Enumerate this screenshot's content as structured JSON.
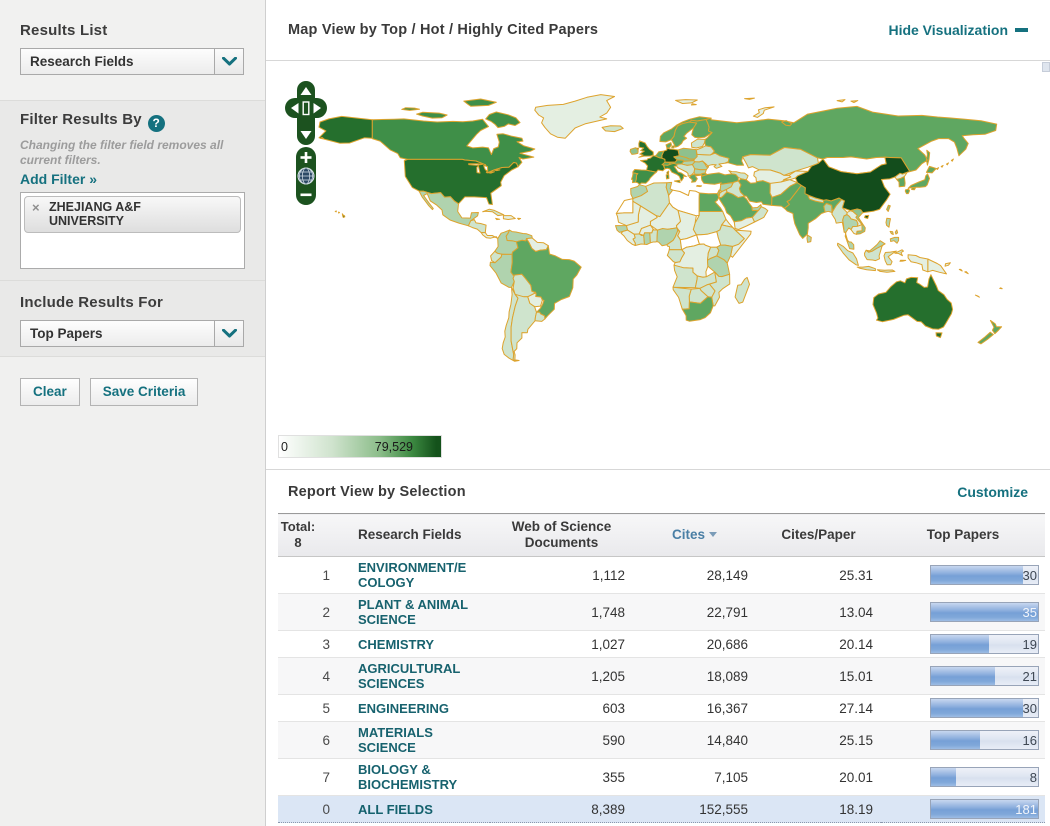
{
  "sidebar": {
    "results_list_label": "Results List",
    "results_list_value": "Research Fields",
    "filter_title": "Filter Results By",
    "filter_help": "?",
    "filter_note": "Changing the filter field removes all current filters.",
    "add_filter_label": "Add Filter »",
    "filter_tag": {
      "remove_icon": "×",
      "text": "ZHEJIANG A&F UNIVERSITY"
    },
    "include_results_label": "Include Results For",
    "include_results_value": "Top Papers",
    "clear_button": "Clear",
    "save_button": "Save Criteria"
  },
  "map": {
    "title": "Map View by Top / Hot / Highly Cited Papers",
    "hide_link": "Hide Visualization",
    "zoom_in": "+",
    "zoom_out": "−",
    "legend_min": "0",
    "legend_max": "79,529",
    "palette": [
      "#ffffff",
      "#e4efe2",
      "#cfe4cd",
      "#b0d3ae",
      "#8fc18d",
      "#5fa761",
      "#3f8f48",
      "#256f2d",
      "#134d1c"
    ],
    "border_color": "#dda32d"
  },
  "report": {
    "title": "Report View by Selection",
    "customize_link": "Customize",
    "total_label": "Total:",
    "total_value": "8",
    "columns": {
      "field": "Research Fields",
      "docs": "Web of Science Documents",
      "cites": "Cites",
      "cites_per_paper": "Cites/Paper",
      "top_papers": "Top Papers"
    },
    "sorted_by": "Cites",
    "rows": [
      {
        "rank": "1",
        "field": "ENVIRONMENT/ECOLOGY",
        "docs": "1,112",
        "cites": "28,149",
        "cites_per_paper": "25.31",
        "top_papers": "30",
        "bar_pct": 86,
        "total": false
      },
      {
        "rank": "2",
        "field": "PLANT & ANIMAL SCIENCE",
        "docs": "1,748",
        "cites": "22,791",
        "cites_per_paper": "13.04",
        "top_papers": "35",
        "bar_pct": 100,
        "total": false
      },
      {
        "rank": "3",
        "field": "CHEMISTRY",
        "docs": "1,027",
        "cites": "20,686",
        "cites_per_paper": "20.14",
        "top_papers": "19",
        "bar_pct": 54,
        "total": false
      },
      {
        "rank": "4",
        "field": "AGRICULTURAL SCIENCES",
        "docs": "1,205",
        "cites": "18,089",
        "cites_per_paper": "15.01",
        "top_papers": "21",
        "bar_pct": 60,
        "total": false
      },
      {
        "rank": "5",
        "field": "ENGINEERING",
        "docs": "603",
        "cites": "16,367",
        "cites_per_paper": "27.14",
        "top_papers": "30",
        "bar_pct": 86,
        "total": false
      },
      {
        "rank": "6",
        "field": "MATERIALS SCIENCE",
        "docs": "590",
        "cites": "14,840",
        "cites_per_paper": "25.15",
        "top_papers": "16",
        "bar_pct": 46,
        "total": false
      },
      {
        "rank": "7",
        "field": "BIOLOGY & BIOCHEMISTRY",
        "docs": "355",
        "cites": "7,105",
        "cites_per_paper": "20.01",
        "top_papers": "8",
        "bar_pct": 23,
        "total": false
      },
      {
        "rank": "0",
        "field": "ALL FIELDS",
        "docs": "8,389",
        "cites": "152,555",
        "cites_per_paper": "18.19",
        "top_papers": "181",
        "bar_pct": 100,
        "total": true
      }
    ]
  }
}
